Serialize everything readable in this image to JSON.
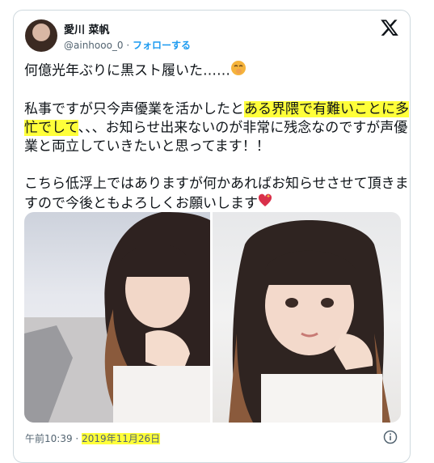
{
  "tweet": {
    "display_name": "愛川 菜帆",
    "handle": "@ainhooo_0",
    "separator": "·",
    "follow_label": "フォローする",
    "text_line1": "何億光年ぶりに黒スト履いた……",
    "text_p2_pre": "私事ですが只今声優業を活かしたと",
    "text_p2_highlight": "ある界隈で有難いことに多忙でして",
    "text_p2_post": "、、、お知らせ出来ないのが非常に残念なのですが声優業と両立していきたいと思ってます！！",
    "text_p3": "こちら低浮上ではありますが何かあればお知らせさせて頂きますので今後ともよろしくお願いします",
    "time": "午前10:39",
    "footer_separator": "·",
    "date": "2019年11月26日"
  },
  "icons": {
    "x_logo": "x-logo-icon",
    "emoji_1": "hush-face-emoji",
    "emoji_2": "sparkling-heart-emoji",
    "info": "info-icon"
  },
  "colors": {
    "highlight": "#ffff3a",
    "link": "#1d9bf0",
    "muted": "#536471"
  }
}
